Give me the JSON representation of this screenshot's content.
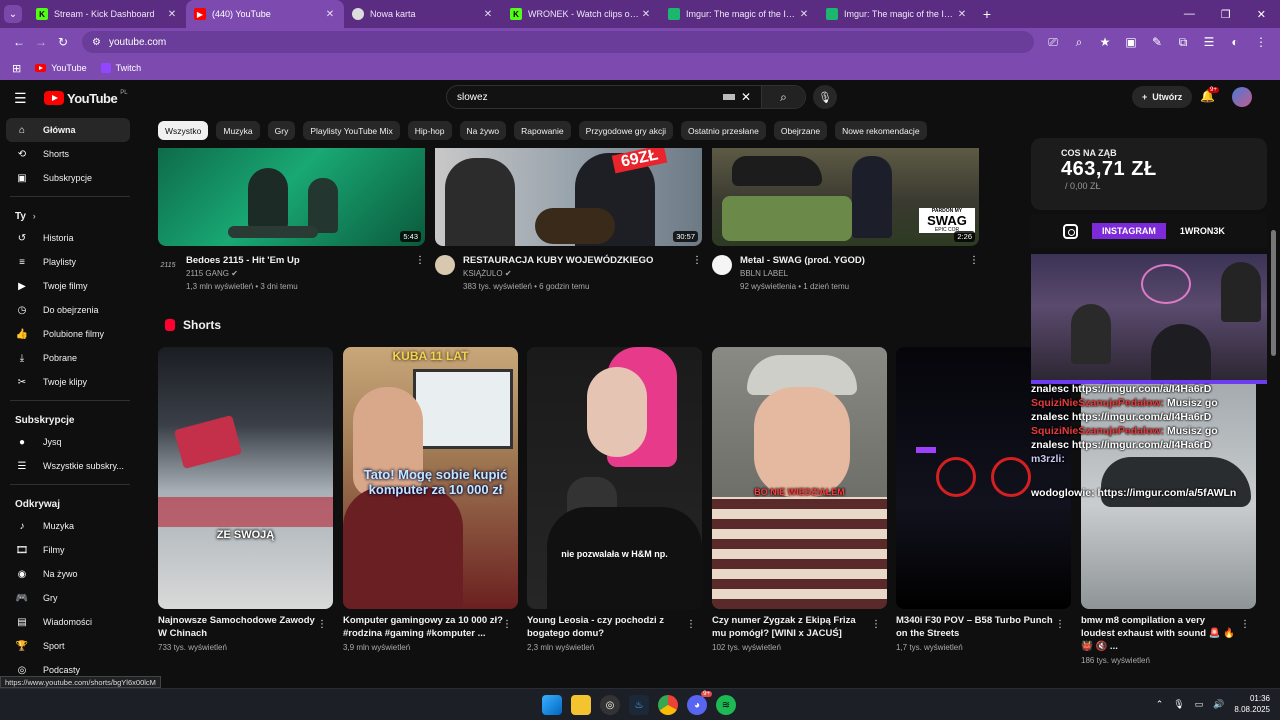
{
  "browser": {
    "tabs": [
      {
        "title": "Stream - Kick Dashboard",
        "fav": "K",
        "favColor": "#53fc18",
        "active": false
      },
      {
        "title": "(440) YouTube",
        "fav": "yt",
        "favColor": "#ff0000",
        "active": true
      },
      {
        "title": "Nowa karta",
        "fav": "chrome",
        "favColor": "#dddddd",
        "active": false
      },
      {
        "title": "WRONEK - Watch clips on Kick",
        "fav": "K",
        "favColor": "#53fc18",
        "active": false
      },
      {
        "title": "Imgur: The magic of the Internet",
        "fav": "img",
        "favColor": "#1bb76e",
        "active": false
      },
      {
        "title": "Imgur: The magic of the Internet",
        "fav": "img",
        "favColor": "#1bb76e",
        "active": false
      }
    ],
    "url": "youtube.com",
    "bookmarks": [
      "YouTube",
      "Twitch"
    ],
    "status_url": "https://www.youtube.com/shorts/bgYl6x00lcM"
  },
  "header": {
    "logo_text": "YouTube",
    "logo_region": "PL",
    "search_value": "slowez",
    "create_label": "Utwórz",
    "notif_count": "9+"
  },
  "sidebar": {
    "main": [
      {
        "label": "Główna",
        "icon": "home-icon",
        "glyph": "⌂",
        "active": true
      },
      {
        "label": "Shorts",
        "icon": "shorts-icon",
        "glyph": "⟲",
        "active": false
      },
      {
        "label": "Subskrypcje",
        "icon": "subscriptions-icon",
        "glyph": "▣",
        "active": false
      }
    ],
    "you_heading": "Ty",
    "you": [
      {
        "label": "Historia",
        "icon": "history-icon",
        "glyph": "↺"
      },
      {
        "label": "Playlisty",
        "icon": "playlists-icon",
        "glyph": "≡"
      },
      {
        "label": "Twoje filmy",
        "icon": "your-videos-icon",
        "glyph": "▶"
      },
      {
        "label": "Do obejrzenia",
        "icon": "watch-later-icon",
        "glyph": "◷"
      },
      {
        "label": "Polubione filmy",
        "icon": "liked-icon",
        "glyph": "👍"
      },
      {
        "label": "Pobrane",
        "icon": "download-icon",
        "glyph": "⤓"
      },
      {
        "label": "Twoje klipy",
        "icon": "clips-icon",
        "glyph": "✂"
      }
    ],
    "subs_heading": "Subskrypcje",
    "subs": [
      {
        "label": "Jysq",
        "icon": "channel-avatar-icon",
        "glyph": "●"
      },
      {
        "label": "Wszystkie subskry...",
        "icon": "all-subscriptions-icon",
        "glyph": "☰"
      }
    ],
    "explore_heading": "Odkrywaj",
    "explore": [
      {
        "label": "Muzyka",
        "icon": "music-icon",
        "glyph": "♪"
      },
      {
        "label": "Filmy",
        "icon": "movies-icon",
        "glyph": "🎞"
      },
      {
        "label": "Na żywo",
        "icon": "live-icon",
        "glyph": "◉"
      },
      {
        "label": "Gry",
        "icon": "gaming-icon",
        "glyph": "🎮"
      },
      {
        "label": "Wiadomości",
        "icon": "news-icon",
        "glyph": "▤"
      },
      {
        "label": "Sport",
        "icon": "sport-icon",
        "glyph": "🏆"
      },
      {
        "label": "Podcasty",
        "icon": "podcasts-icon",
        "glyph": "◎"
      }
    ]
  },
  "chips": [
    "Wszystko",
    "Muzyka",
    "Gry",
    "Playlisty YouTube Mix",
    "Hip-hop",
    "Na żywo",
    "Rapowanie",
    "Przygodowe gry akcji",
    "Ostatnio przesłane",
    "Obejrzane",
    "Nowe rekomendacje"
  ],
  "videos": [
    {
      "title": "Bedoes 2115 - Hit 'Em Up",
      "channel": "2115 GANG",
      "verified": true,
      "meta": "1,3 mln wyświetleń • 3 dni temu",
      "duration": "5:43",
      "avatar_text": "2115"
    },
    {
      "title": "RESTAURACJA KUBY WOJEWÓDZKIEGO",
      "channel": "KSIĄŻULO",
      "verified": true,
      "meta": "383 tys. wyświetleń • 6 godzin temu",
      "duration": "30:57",
      "thumb_text": "69ZŁ"
    },
    {
      "title": "Metal - SWAG (prod. YGOD)",
      "channel": "BBLN LABEL",
      "verified": false,
      "meta": "92 wyświetlenia • 1 dzień temu",
      "duration": "2:26",
      "thumb_text": "SWAG",
      "thumb_text2": "PARDON MY",
      "thumb_text3": "EPIC COR"
    }
  ],
  "shorts_heading": "Shorts",
  "shorts": [
    {
      "title": "Najnowsze Samochodowe Zawody W Chinach",
      "views": "733 tys. wyświetleń",
      "caption": "ZE SWOJĄ"
    },
    {
      "title": "Komputer gamingowy za 10 000 zł? #rodzina #gaming #komputer ...",
      "views": "3,9 mln wyświetleń",
      "caption_top": "KUBA 11 LAT",
      "caption": "Tato! Mogę sobie kupić komputer za 10 000 zł"
    },
    {
      "title": "Young Leosia - czy pochodzi z bogatego domu?",
      "views": "2,3 mln wyświetleń",
      "caption": "nie pozwalała w H&M np."
    },
    {
      "title": "Czy numer Zygzak z Ekipą Friza mu pomógł? [WINI x JACUŚ]",
      "views": "102 tys. wyświetleń",
      "caption": "BO NIE WIEDZIAŁEM"
    },
    {
      "title": "M340i F30 POV – B58 Turbo Punch on the Streets",
      "views": "1,7 tys. wyświetleń"
    },
    {
      "title": "bmw m8 compilation a very loudest exhaust with sound 🚨 🔥 👹 🔇 ...",
      "views": "186 tys. wyświetleń"
    }
  ],
  "overlay": {
    "label": "COS NA ZĄB",
    "amount": "463,71 ZŁ",
    "sub": "/ 0,00 ZŁ",
    "insta_tag": "INSTAGRAM",
    "insta_name": "1WRON3K",
    "chat": [
      {
        "user": "znalesc",
        "text": "https://imgur.com/a/I4Ha6rD"
      },
      {
        "user": "SquiziNieSzanujePedalow:",
        "text": "Musisz go"
      },
      {
        "user": "znalesc",
        "text": "https://imgur.com/a/I4Ha6rD"
      },
      {
        "user": "SquiziNieSzanujePedalow:",
        "text": "Musisz go"
      },
      {
        "user": "znalesc",
        "text": "https://imgur.com/a/I4Ha6rD"
      },
      {
        "user": "m3rzli:",
        "text": ""
      },
      {
        "user": "wodoglowie:",
        "text": "https://imgur.com/a/5fAWLn"
      }
    ]
  },
  "taskbar": {
    "time": "01:36",
    "date": "8.08.2025",
    "discord_badge": "9+"
  },
  "colors": {
    "accent": "#7d4bb0",
    "youtube_red": "#ff0000"
  }
}
